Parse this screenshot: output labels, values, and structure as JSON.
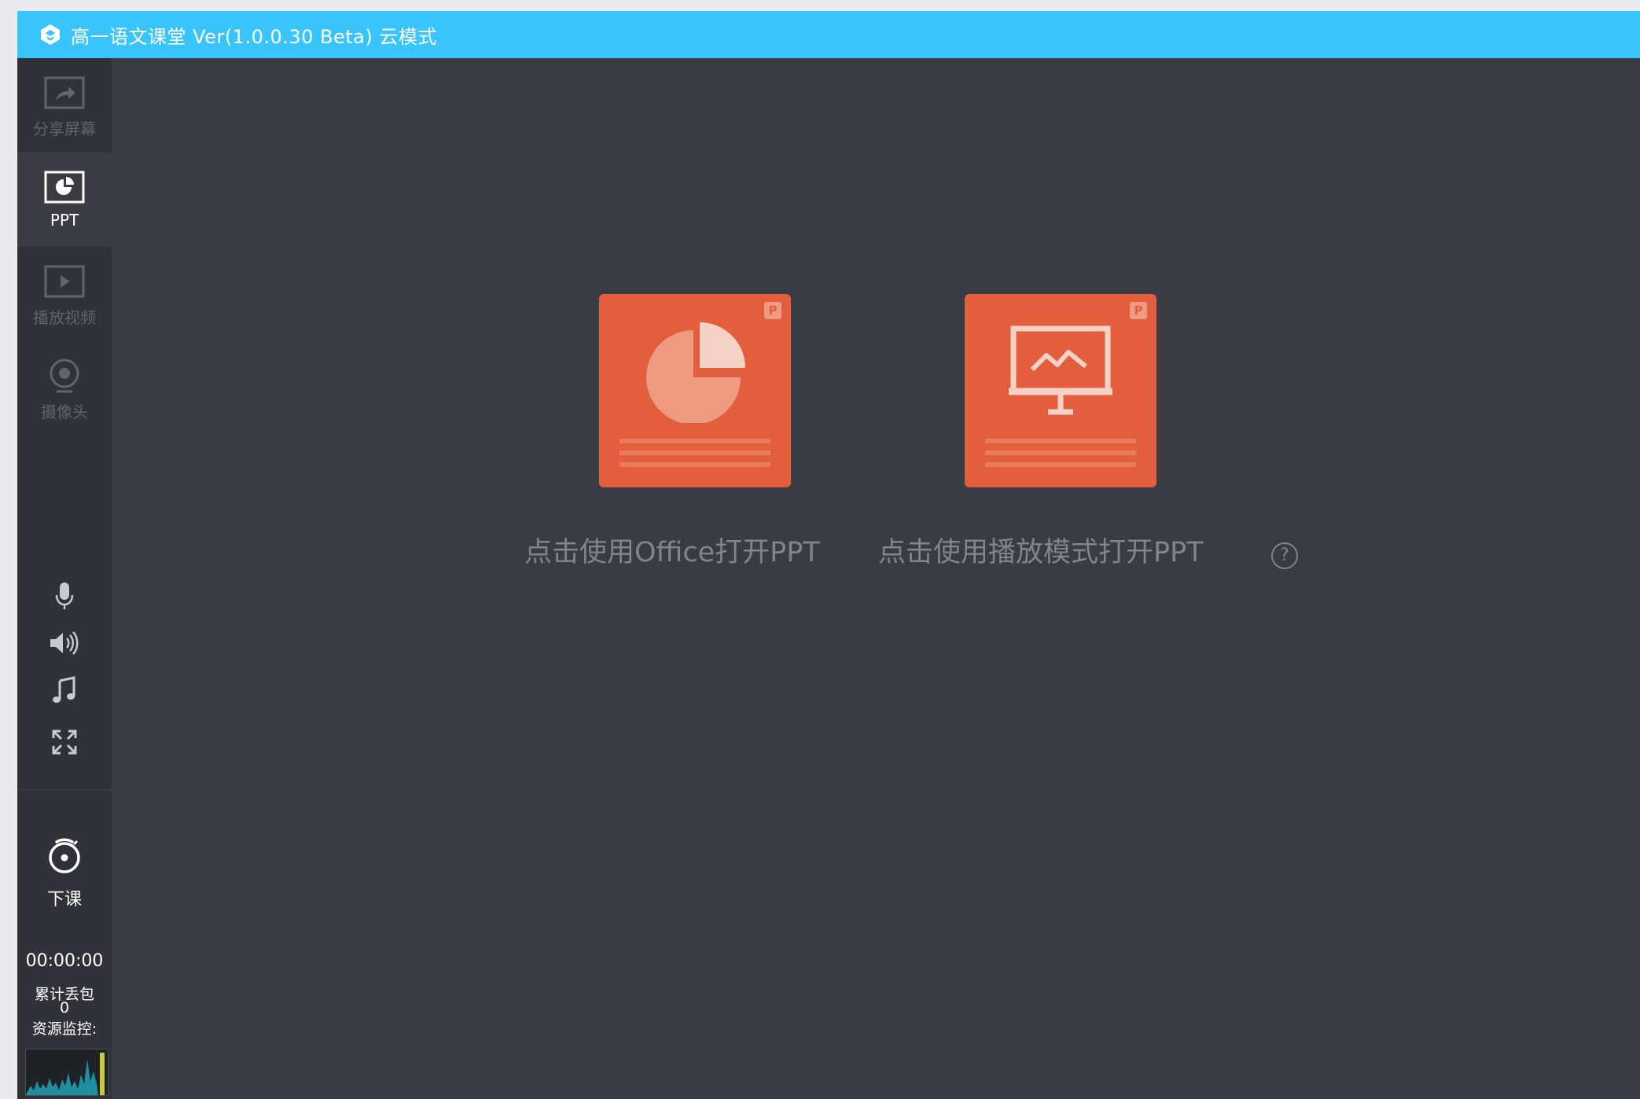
{
  "titlebar": {
    "title": "高一语文课堂 Ver(1.0.0.30 Beta)  云模式"
  },
  "sidebar": {
    "items": [
      {
        "label": "分享屏幕",
        "icon": "share-screen-icon"
      },
      {
        "label": "PPT",
        "icon": "ppt-icon"
      },
      {
        "label": "播放视频",
        "icon": "play-video-icon"
      },
      {
        "label": "摄像头",
        "icon": "camera-icon"
      }
    ],
    "tools": [
      "microphone-icon",
      "speaker-icon",
      "music-icon",
      "fullscreen-icon"
    ],
    "end_class_label": "下课",
    "timer": "00:00:00",
    "packet_loss_label": "累计丢包",
    "packet_loss_value": "0",
    "resource_monitor_label": "资源监控:"
  },
  "main": {
    "office_caption": "点击使用Office打开PPT",
    "play_caption": "点击使用播放模式打开PPT",
    "badge": "P",
    "help": "?"
  },
  "colors": {
    "titlebar": "#39c5fb",
    "sidebar": "#2f3238",
    "main_bg": "#393c43",
    "card": "#e25e3d"
  }
}
